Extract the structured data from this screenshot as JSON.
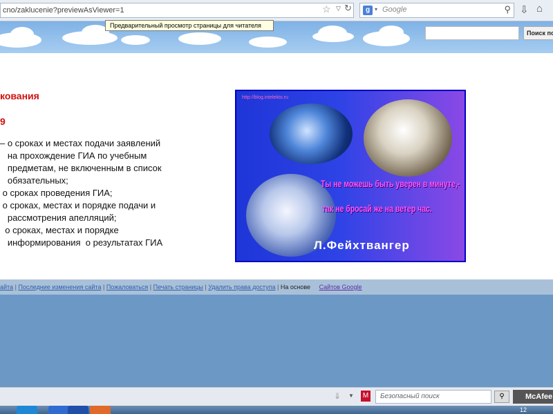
{
  "browser": {
    "url": "cno/zaklucenie?previewAsViewer=1",
    "search_placeholder": "Google",
    "search_engine_letter": "g"
  },
  "tooltip": "Предварительный просмотр страницы для читателя",
  "site_search": {
    "button": "Поиск по"
  },
  "content": {
    "heading_partial": "кования",
    "subheading_partial": "9",
    "body_text": "– о сроках и местах подачи заявлений\n   на прохождение ГИА по учебным\n   предметам, не включенным в список\n   обязательных;\n о сроках проведения ГИА;\n о сроках, местах и порядке подачи и\n   рассмотрения апелляций;\n  о сроках, местах и порядке\n   информирования  о результатах ГИА"
  },
  "image": {
    "url_text": "http://blog.intelekto.ru",
    "quote_line1": "Ты не можешь быть уверен в минуте,-",
    "quote_line2": "так не бросай же на ветер час.",
    "author": "Л.Фейхтвангер"
  },
  "footer": {
    "links": [
      "айта",
      "Последние изменения сайта",
      "Пожаловаться",
      "Печать страницы",
      "Удалить права доступа"
    ],
    "based_on": "На основе",
    "google_sites": "Сайтов Google"
  },
  "statusbar": {
    "safe_search_placeholder": "Безопасный поиск",
    "mcafee": "McAfee",
    "clock": "12"
  },
  "colors": {
    "accent_red": "#cc1111",
    "link_blue": "#2f5fa8",
    "google_sites": "#5a2fa0",
    "image_blue": "#1e35d7",
    "quote_pink": "#ff55ff"
  }
}
